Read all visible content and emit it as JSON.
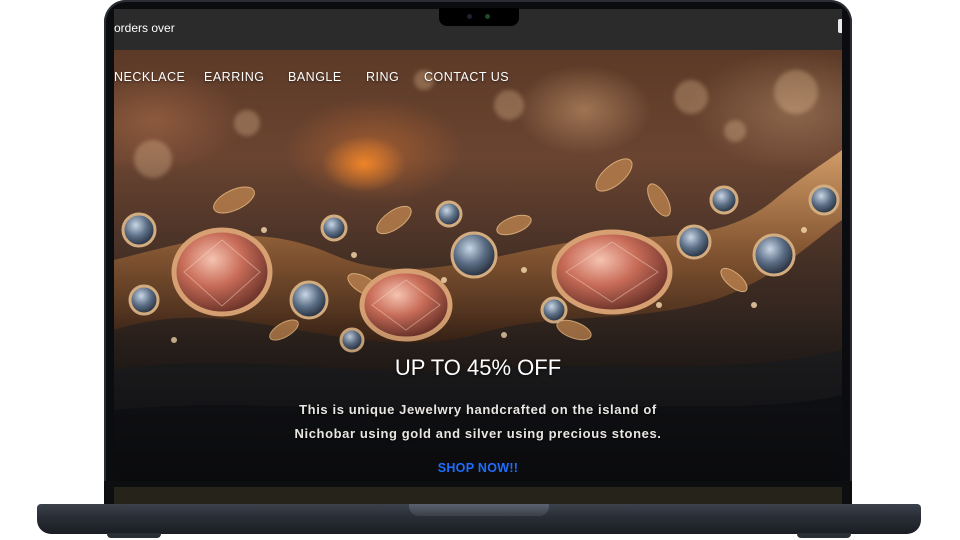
{
  "announcement": {
    "text": "orders over"
  },
  "nav": {
    "items": [
      {
        "label": "NECKLACE"
      },
      {
        "label": "EARRING"
      },
      {
        "label": "BANGLE"
      },
      {
        "label": "RING"
      },
      {
        "label": "CONTACT US"
      }
    ]
  },
  "hero": {
    "title": "UP TO 45% OFF",
    "description_line1": "This is unique Jewelwry handcrafted on the island of",
    "description_line2": "Nichobar using gold and silver using precious stones.",
    "cta_label": "SHOP NOW!!",
    "cta_color": "#1f6dff"
  },
  "colors": {
    "announcement_bg": "#2b2b2b",
    "device_frame": "#0b0c0f"
  }
}
